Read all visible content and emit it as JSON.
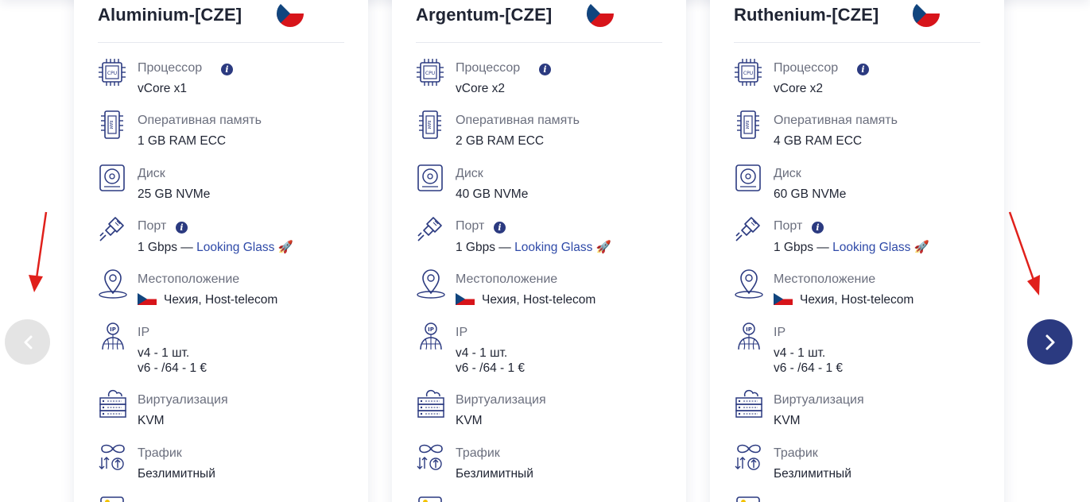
{
  "cards": [
    {
      "title": "Aluminium-[CZE]",
      "specs": {
        "cpu_label": "Процессор",
        "cpu_value": "vCore x1",
        "ram_label": "Оперативная память",
        "ram_value": "1 GB RAM ECC",
        "disk_label": "Диск",
        "disk_value": "25 GB NVMe",
        "port_label": "Порт",
        "port_speed": "1 Gbps — ",
        "port_link": "Looking Glass",
        "port_emoji": "🚀",
        "loc_label": "Местоположение",
        "loc_value": "Чехия, Host-telecom",
        "ip_label": "IP",
        "ip_v4": "v4 - 1 шт.",
        "ip_v6": "v6 - /64 - 1 €",
        "virt_label": "Виртуализация",
        "virt_value": "KVM",
        "traffic_label": "Трафик",
        "traffic_value": "Безлимитный"
      }
    },
    {
      "title": "Argentum-[CZE]",
      "specs": {
        "cpu_label": "Процессор",
        "cpu_value": "vCore x2",
        "ram_label": "Оперативная память",
        "ram_value": "2 GB RAM ECC",
        "disk_label": "Диск",
        "disk_value": "40 GB NVMe",
        "port_label": "Порт",
        "port_speed": "1 Gbps — ",
        "port_link": "Looking Glass",
        "port_emoji": "🚀",
        "loc_label": "Местоположение",
        "loc_value": "Чехия, Host-telecom",
        "ip_label": "IP",
        "ip_v4": "v4 - 1 шт.",
        "ip_v6": "v6 - /64 - 1 €",
        "virt_label": "Виртуализация",
        "virt_value": "KVM",
        "traffic_label": "Трафик",
        "traffic_value": "Безлимитный"
      }
    },
    {
      "title": "Ruthenium-[CZE]",
      "specs": {
        "cpu_label": "Процессор",
        "cpu_value": "vCore x2",
        "ram_label": "Оперативная память",
        "ram_value": "4 GB RAM ECC",
        "disk_label": "Диск",
        "disk_value": "60 GB NVMe",
        "port_label": "Порт",
        "port_speed": "1 Gbps — ",
        "port_link": "Looking Glass",
        "port_emoji": "🚀",
        "loc_label": "Местоположение",
        "loc_value": "Чехия, Host-telecom",
        "ip_label": "IP",
        "ip_v4": "v4 - 1 шт.",
        "ip_v6": "v6 - /64 - 1 €",
        "virt_label": "Виртуализация",
        "virt_value": "KVM",
        "traffic_label": "Трафик",
        "traffic_value": "Безлимитный"
      }
    }
  ],
  "icons": {
    "cpu": "cpu-icon",
    "ram": "ram-icon",
    "disk": "disk-icon",
    "port": "ethernet-cable-icon",
    "location": "map-pin-icon",
    "ip": "ip-globe-icon",
    "virtualization": "server-rack-icon",
    "traffic": "infinity-traffic-icon",
    "info": "info-icon",
    "flag": "czech-flag-icon",
    "prev": "chevron-left-icon",
    "next": "chevron-right-icon"
  },
  "colors": {
    "brand": "#2b3a80",
    "link": "#2f4aa8",
    "label_text": "#6b6f7e",
    "value_text": "#1f2433",
    "annotation_arrow": "#e0201b",
    "prev_button_bg": "#e4e4e4",
    "next_button_bg": "#2b3a80",
    "flag_white": "#ffffff",
    "flag_red": "#d7141a",
    "flag_blue": "#11457e"
  }
}
